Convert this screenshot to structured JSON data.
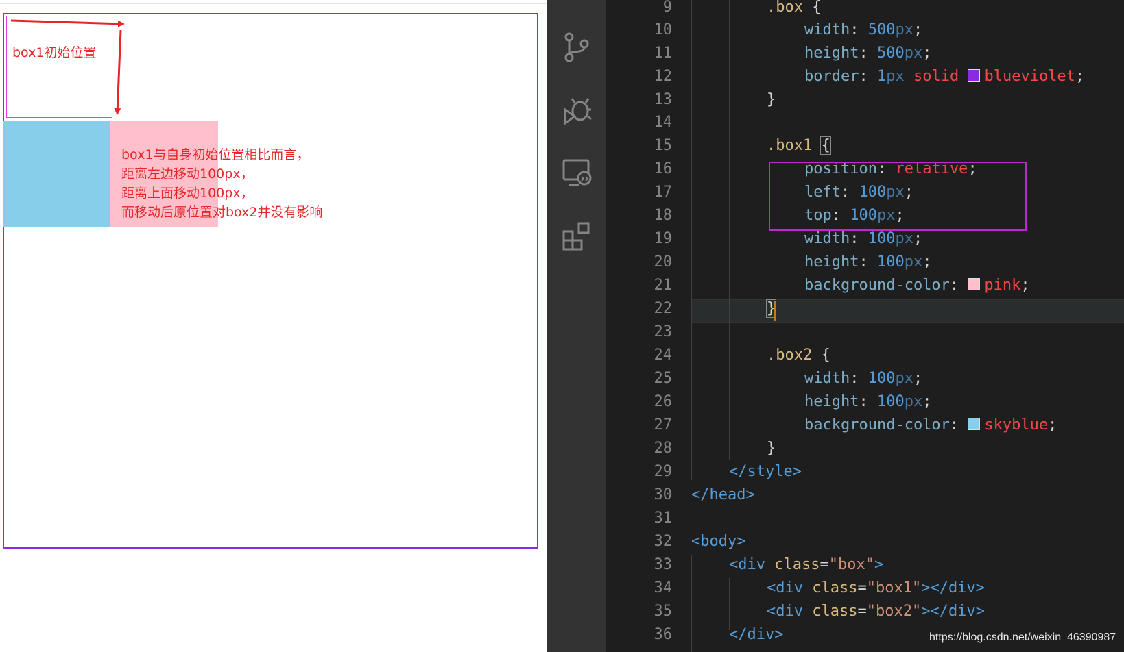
{
  "preview": {
    "initial_label": "box1初始位置",
    "description_lines": [
      "box1与自身初始位置相比而言，",
      "距离左边移动100px，",
      "距离上面移动100px，",
      "而移动后原位置对box2并没有影响"
    ],
    "colors": {
      "box_border": "#8a2be2",
      "box1": "#ffc0cb",
      "box2": "#87ceeb",
      "annotation": "#e8262a"
    }
  },
  "activity_bar": {
    "icons": [
      "source-control-icon",
      "debug-icon",
      "remote-explorer-icon",
      "extensions-icon"
    ]
  },
  "editor": {
    "line_numbers": [
      "9",
      "10",
      "11",
      "12",
      "13",
      "14",
      "15",
      "16",
      "17",
      "18",
      "19",
      "20",
      "21",
      "22",
      "23",
      "24",
      "25",
      "26",
      "27",
      "28",
      "29",
      "30",
      "31",
      "32",
      "33",
      "34",
      "35",
      "36"
    ],
    "tokens": {
      "box_sel": ".box",
      "box1_sel": ".box1",
      "box2_sel": ".box2",
      "open": "{",
      "close": "}",
      "colon": ":",
      "semi": ";",
      "width": "width",
      "height": "height",
      "border": "border",
      "position": "position",
      "left": "left",
      "top": "top",
      "bgcolor": "background-color",
      "n500": "500",
      "n100": "100",
      "n1": "1",
      "px": "px",
      "solid": "solid",
      "blueviolet": "blueviolet",
      "relative": "relative",
      "pink": "pink",
      "skyblue": "skyblue",
      "style_close": "</style>",
      "head_close": "</head>",
      "body_open": "<body>",
      "div_open": "<div",
      "div_close": "</div>",
      "class_attr": "class",
      "eq": "=",
      "str_box": "\"box\"",
      "str_box1": "\"box1\"",
      "str_box2": "\"box2\"",
      "gt": ">",
      "gt_div_close": "></div>"
    },
    "swatches": {
      "blueviolet": "#8a2be2",
      "pink": "#ffc0cb",
      "skyblue": "#87ceeb"
    }
  },
  "watermark": "https://blog.csdn.net/weixin_46390987"
}
